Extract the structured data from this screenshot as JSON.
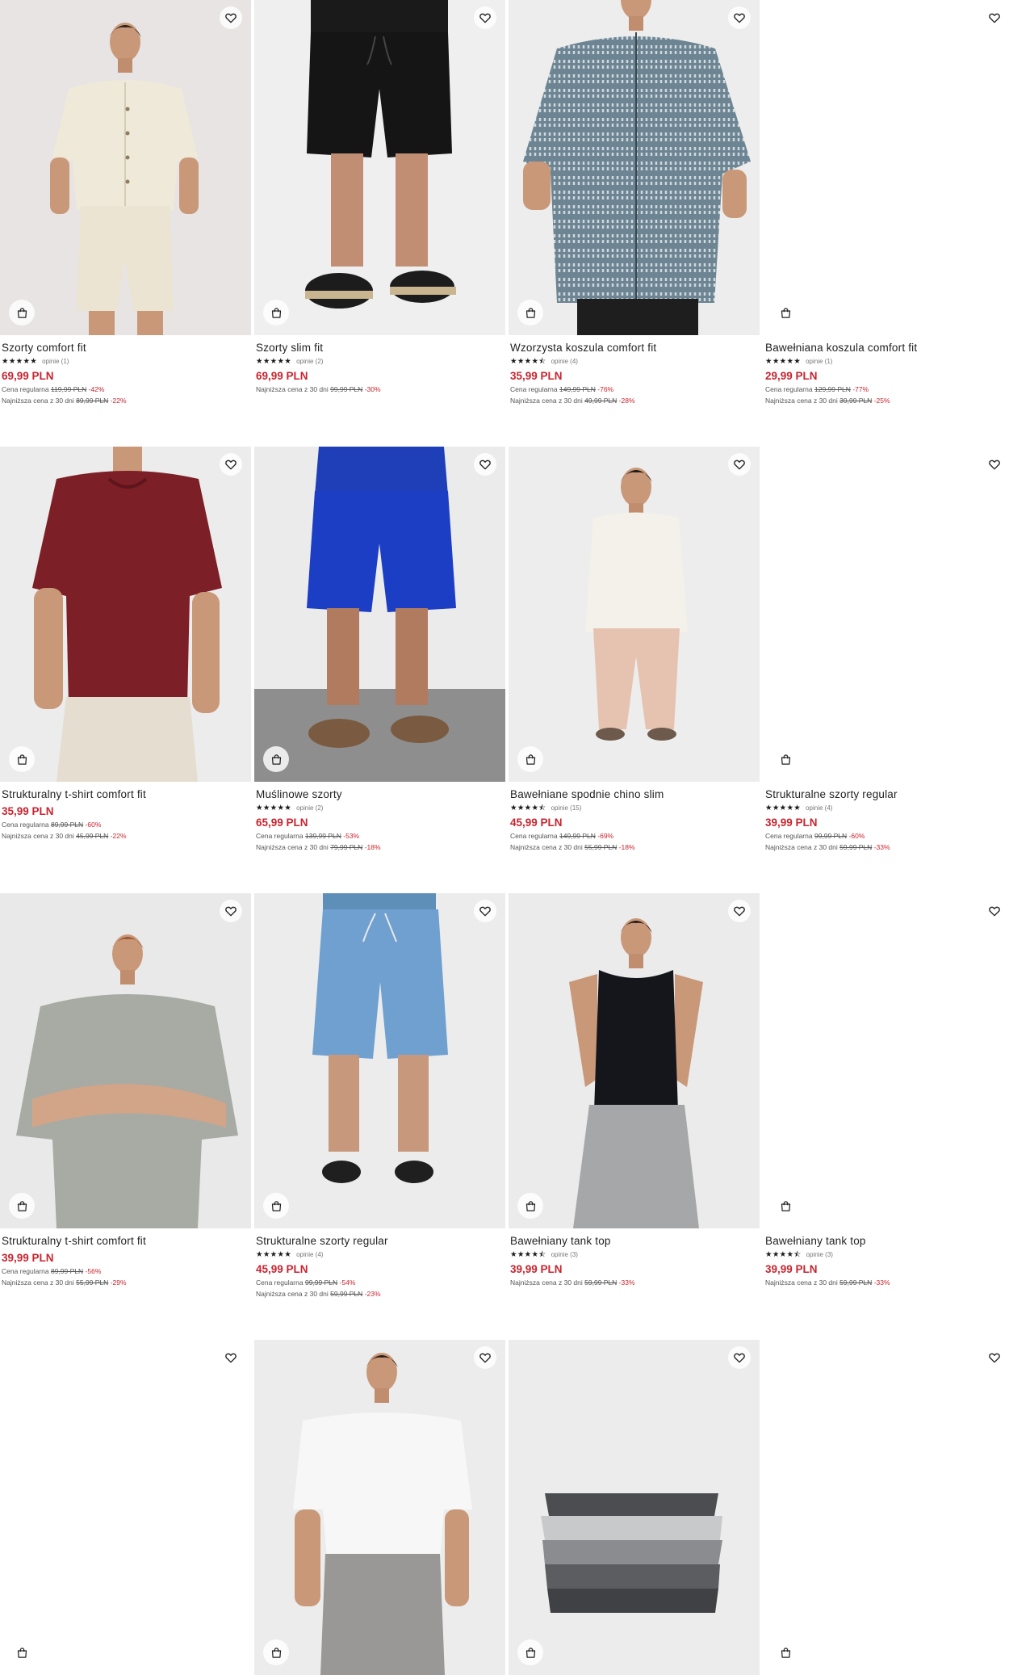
{
  "products": [
    {
      "name": "Szorty comfort fit",
      "stars": "★★★★★",
      "reviews": "opinie (1)",
      "price": "69,99 PLN",
      "regular_label": "Cena regularna",
      "regular_price": "119,99 PLN",
      "regular_discount": "-42%",
      "lowest_label": "Najniższa cena z 30 dni",
      "lowest_price": "89,99 PLN",
      "lowest_discount": "-22%",
      "image": "man-cream-shirt-shorts"
    },
    {
      "name": "Szorty slim fit",
      "stars": "★★★★★",
      "reviews": "opinie (2)",
      "price": "69,99 PLN",
      "lowest_label": "Najniższa cena z 30 dni",
      "lowest_price": "99,99 PLN",
      "lowest_discount": "-30%",
      "image": "black-shorts-espadrilles"
    },
    {
      "name": "Wzorzysta koszula comfort fit",
      "stars": "★★★★⯪",
      "reviews": "opinie (4)",
      "price": "35,99 PLN",
      "regular_label": "Cena regularna",
      "regular_price": "149,99 PLN",
      "regular_discount": "-76%",
      "lowest_label": "Najniższa cena z 30 dni",
      "lowest_price": "49,99 PLN",
      "lowest_discount": "-28%",
      "image": "man-patterned-shirt"
    },
    {
      "name": "Bawełniana koszula comfort fit",
      "stars": "★★★★★",
      "reviews": "opinie (1)",
      "price": "29,99 PLN",
      "regular_label": "Cena regularna",
      "regular_price": "129,99 PLN",
      "regular_discount": "-77%",
      "lowest_label": "Najniższa cena z 30 dni",
      "lowest_price": "39,99 PLN",
      "lowest_discount": "-25%",
      "image": "blank"
    },
    {
      "name": "Strukturalny t-shirt comfort fit",
      "price": "35,99 PLN",
      "regular_label": "Cena regularna",
      "regular_price": "89,99 PLN",
      "regular_discount": "-60%",
      "lowest_label": "Najniższa cena z 30 dni",
      "lowest_price": "45,99 PLN",
      "lowest_discount": "-22%",
      "image": "man-burgundy-tshirt"
    },
    {
      "name": "Muślinowe szorty",
      "stars": "★★★★★",
      "reviews": "opinie (2)",
      "price": "65,99 PLN",
      "regular_label": "Cena regularna",
      "regular_price": "139,99 PLN",
      "regular_discount": "-53%",
      "lowest_label": "Najniższa cena z 30 dni",
      "lowest_price": "79,99 PLN",
      "lowest_discount": "-18%",
      "image": "blue-shorts-sandals"
    },
    {
      "name": "Bawełniane spodnie chino slim",
      "stars": "★★★★⯪",
      "reviews": "opinie (15)",
      "price": "45,99 PLN",
      "regular_label": "Cena regularna",
      "regular_price": "149,99 PLN",
      "regular_discount": "-69%",
      "lowest_label": "Najniższa cena z 30 dni",
      "lowest_price": "55,99 PLN",
      "lowest_discount": "-18%",
      "image": "man-white-shirt-chinos"
    },
    {
      "name": "Strukturalne szorty regular",
      "stars": "★★★★★",
      "reviews": "opinie (4)",
      "price": "39,99 PLN",
      "regular_label": "Cena regularna",
      "regular_price": "99,99 PLN",
      "regular_discount": "-60%",
      "lowest_label": "Najniższa cena z 30 dni",
      "lowest_price": "59,99 PLN",
      "lowest_discount": "-33%",
      "image": "blank"
    },
    {
      "name": "Strukturalny t-shirt comfort fit",
      "price": "39,99 PLN",
      "regular_label": "Cena regularna",
      "regular_price": "89,99 PLN",
      "regular_discount": "-56%",
      "lowest_label": "Najniższa cena z 30 dni",
      "lowest_price": "55,99 PLN",
      "lowest_discount": "-29%",
      "image": "man-grey-tshirt"
    },
    {
      "name": "Strukturalne szorty regular",
      "stars": "★★★★★",
      "reviews": "opinie (4)",
      "price": "45,99 PLN",
      "regular_label": "Cena regularna",
      "regular_price": "99,99 PLN",
      "regular_discount": "-54%",
      "lowest_label": "Najniższa cena z 30 dni",
      "lowest_price": "59,99 PLN",
      "lowest_discount": "-23%",
      "image": "light-blue-shorts"
    },
    {
      "name": "Bawełniany tank top",
      "stars": "★★★★⯪",
      "reviews": "opinie (3)",
      "price": "39,99 PLN",
      "lowest_label": "Najniższa cena z 30 dni",
      "lowest_price": "59,99 PLN",
      "lowest_discount": "-33%",
      "image": "man-black-tank-top"
    },
    {
      "name": "Bawełniany tank top",
      "stars": "★★★★⯪",
      "reviews": "opinie (3)",
      "price": "39,99 PLN",
      "lowest_label": "Najniższa cena z 30 dni",
      "lowest_price": "59,99 PLN",
      "lowest_discount": "-33%",
      "image": "blank"
    },
    {
      "image": "blank"
    },
    {
      "image": "man-white-tshirt-grey-shorts"
    },
    {
      "image": "folded-grey-socks"
    },
    {
      "image": "blank"
    }
  ],
  "icons": {
    "favorite": "heart-outline-icon",
    "add_to_cart": "shopping-bag-icon"
  },
  "colors": {
    "sale_price": "#c9242f",
    "text": "#222222",
    "muted": "#555555"
  }
}
